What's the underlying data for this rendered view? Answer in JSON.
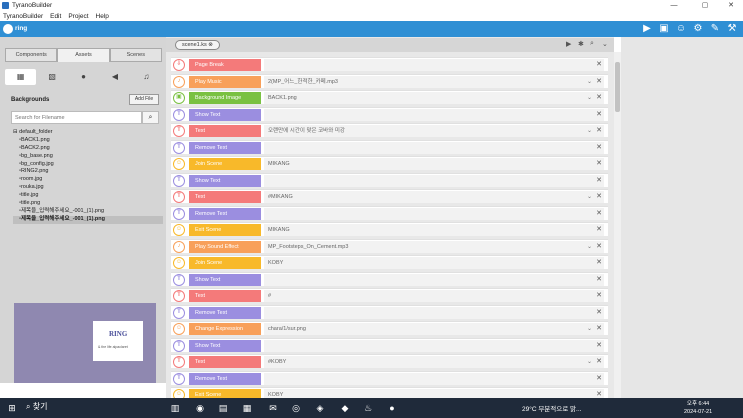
{
  "window": {
    "title": "TyranoBuilder"
  },
  "menu": [
    "TyranoBuilder",
    "Edit",
    "Project",
    "Help"
  ],
  "toolbar": {
    "logo_text": "ring"
  },
  "left": {
    "tabs": [
      "Components",
      "Assets",
      "Scenes"
    ],
    "section_title": "Backgrounds",
    "add_file": "Add File",
    "search_placeholder": "Search for Filename",
    "tree": {
      "folder": "default_folder",
      "files": [
        "BACK1.png",
        "BACK2.png",
        "bg_base.png",
        "bg_config.jpg",
        "RING2.png",
        "room.jpg",
        "rouka.jpg",
        "title.jpg",
        "title.png",
        "제목을_입력해주세요_-001_(1).png",
        "제목을_입력해주세요_-001_(1).png"
      ]
    },
    "preview": {
      "logo": "RING",
      "tagline": "& the life alpaclaret"
    }
  },
  "center": {
    "scene_tab": "scene1.ks",
    "rows": [
      {
        "label": "Page Break",
        "value": "",
        "color": "#f47a7a",
        "icon": "⇩"
      },
      {
        "label": "Play Music",
        "value": "2(MP_어느_한적한_카페.mp3",
        "color": "#f8a05a",
        "icon": "♪"
      },
      {
        "label": "Background Image",
        "value": "BACK1.png",
        "color": "#7ac142",
        "icon": "▣"
      },
      {
        "label": "Show Text",
        "value": "",
        "color": "#9b8ee0",
        "icon": "T"
      },
      {
        "label": "Text",
        "value": "오랜만에 시간이 맞은 코바와 미강",
        "color": "#f47a7a",
        "icon": "T"
      },
      {
        "label": "Remove Text",
        "value": "",
        "color": "#9b8ee0",
        "icon": "T"
      },
      {
        "label": "Join Scene",
        "value": "MIKANG",
        "color": "#f8b92a",
        "icon": "☺"
      },
      {
        "label": "Show Text",
        "value": "",
        "color": "#9b8ee0",
        "icon": "T"
      },
      {
        "label": "Text",
        "value": "#MIKANG",
        "color": "#f47a7a",
        "icon": "T"
      },
      {
        "label": "Remove Text",
        "value": "",
        "color": "#9b8ee0",
        "icon": "T"
      },
      {
        "label": "Exit Scene",
        "value": "MIKANG",
        "color": "#f8b92a",
        "icon": "☺"
      },
      {
        "label": "Play Sound Effect",
        "value": "MP_Footsteps_On_Cement.mp3",
        "color": "#f8a05a",
        "icon": "♪"
      },
      {
        "label": "Join Scene",
        "value": "KOBY",
        "color": "#f8b92a",
        "icon": "☺"
      },
      {
        "label": "Show Text",
        "value": "",
        "color": "#9b8ee0",
        "icon": "T"
      },
      {
        "label": "Text",
        "value": "#",
        "color": "#f47a7a",
        "icon": "T"
      },
      {
        "label": "Remove Text",
        "value": "",
        "color": "#9b8ee0",
        "icon": "T"
      },
      {
        "label": "Change Expression",
        "value": "chara/1/sur.png",
        "color": "#f8a05a",
        "icon": "☺"
      },
      {
        "label": "Show Text",
        "value": "",
        "color": "#9b8ee0",
        "icon": "T"
      },
      {
        "label": "Text",
        "value": "#KOBY",
        "color": "#f47a7a",
        "icon": "T"
      },
      {
        "label": "Remove Text",
        "value": "",
        "color": "#9b8ee0",
        "icon": "T"
      },
      {
        "label": "Exit Scene",
        "value": "KOBY",
        "color": "#f8b92a",
        "icon": "☺"
      }
    ]
  },
  "taskbar": {
    "search": "찾기",
    "weather": "29°C 부분적으로 맑...",
    "time": "오후 6:44",
    "date": "2024-07-21"
  }
}
